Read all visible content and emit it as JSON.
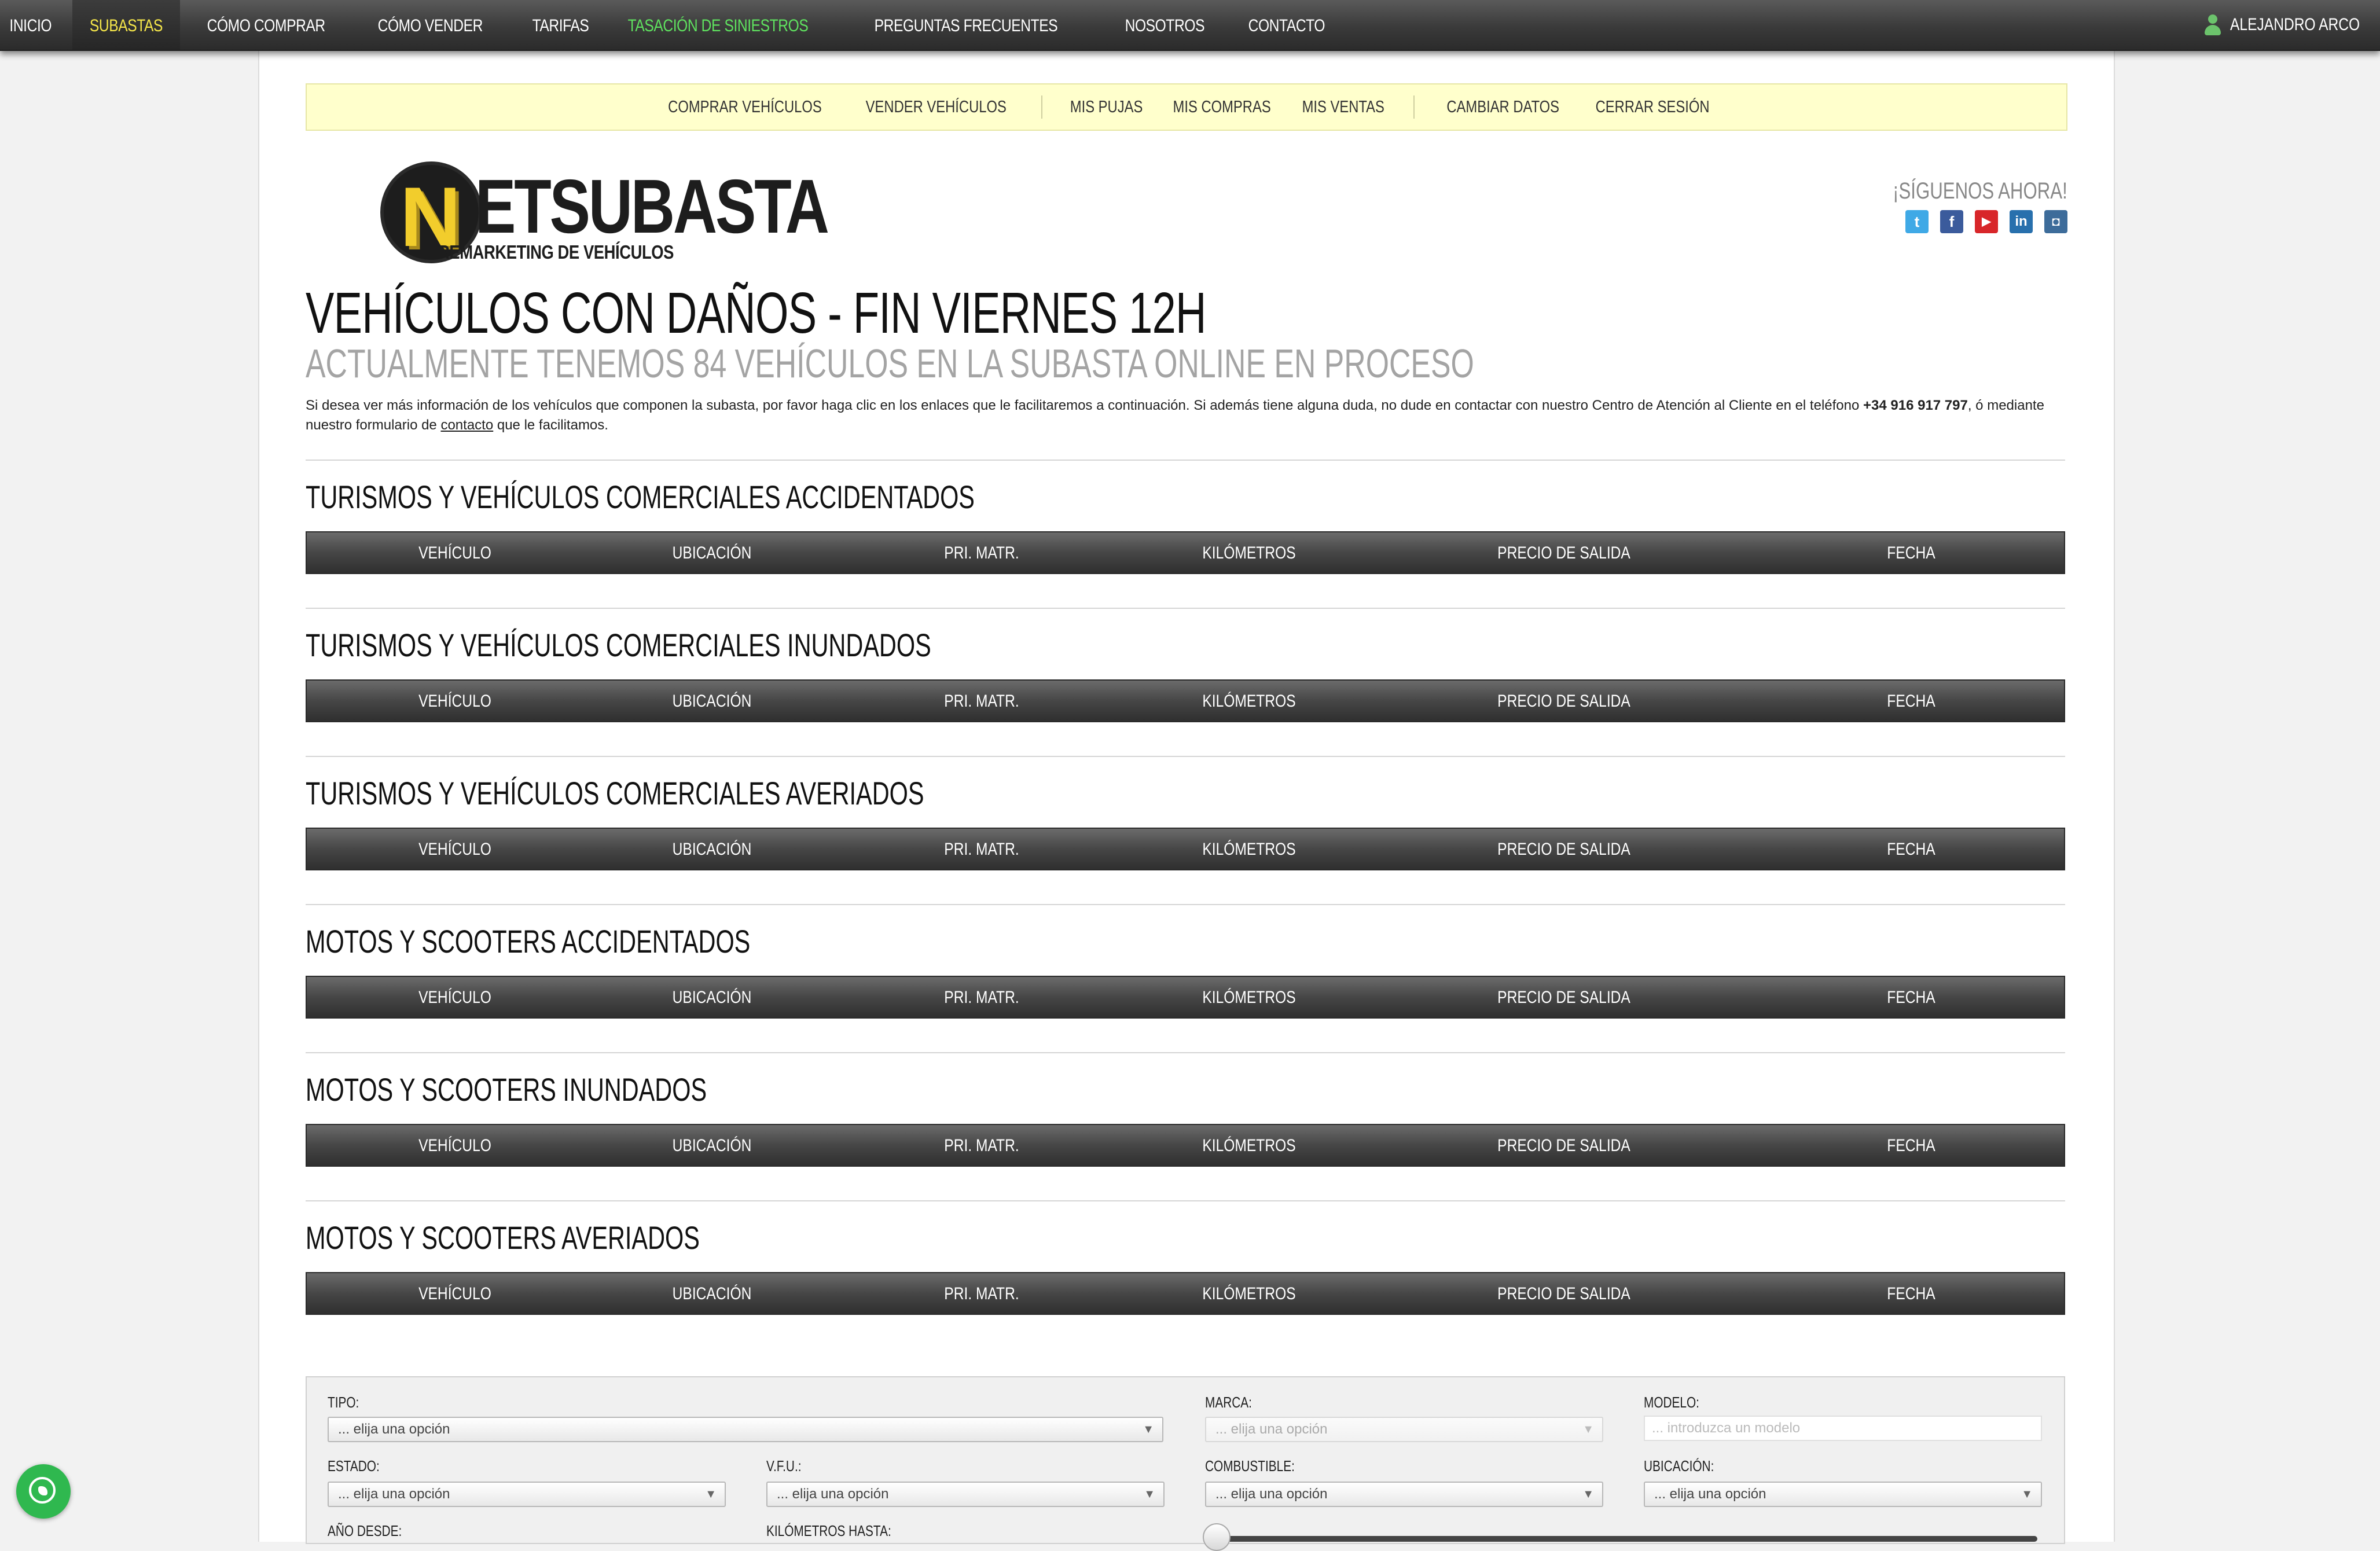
{
  "topnav": {
    "items": [
      {
        "label": "INICIO"
      },
      {
        "label": "SUBASTAS"
      },
      {
        "label": "CÓMO COMPRAR"
      },
      {
        "label": "CÓMO VENDER"
      },
      {
        "label": "TARIFAS"
      },
      {
        "label": "TASACIÓN DE SINIESTROS"
      },
      {
        "label": "PREGUNTAS FRECUENTES"
      },
      {
        "label": "NOSOTROS"
      },
      {
        "label": "CONTACTO"
      }
    ],
    "user": "ALEJANDRO ARCO",
    "active_color": "#f5e64a",
    "highlight_color": "#5fe25f"
  },
  "usernav": {
    "group1": [
      "COMPRAR VEHÍCULOS",
      "VENDER VEHÍCULOS"
    ],
    "group2": [
      "MIS PUJAS",
      "MIS COMPRAS",
      "MIS VENTAS"
    ],
    "group3": [
      "CAMBIAR DATOS",
      "CERRAR SESIÓN"
    ]
  },
  "logo": {
    "letter": "N",
    "word": "ETSUBASTA",
    "tagline": "REMARKETING DE VEHÍCULOS"
  },
  "social": {
    "label": "¡SÍGUENOS AHORA!",
    "icons": [
      "twitter-icon",
      "facebook-icon",
      "youtube-icon",
      "linkedin-icon",
      "instagram-icon"
    ]
  },
  "page": {
    "title": "VEHÍCULOS CON DAÑOS - FIN VIERNES 12H",
    "subtitle": "ACTUALMENTE TENEMOS 84 VEHÍCULOS EN LA SUBASTA ONLINE EN PROCESO",
    "intro_pre": "Si desea ver más información de los vehículos que componen la subasta, por favor haga clic en los enlaces que le facilitaremos a continuación. Si además tiene alguna duda, no dude en contactar con nuestro Centro de Atención al Cliente en el teléfono ",
    "phone": "+34 916 917 797",
    "intro_mid": ", ó mediante nuestro formulario de ",
    "contact_link": "contacto",
    "intro_post": " que le facilitamos."
  },
  "table_columns": [
    "VEHÍCULO",
    "UBICACIÓN",
    "PRI. MATR.",
    "KILÓMETROS",
    "PRECIO DE SALIDA",
    "FECHA"
  ],
  "sections": [
    {
      "title": "TURISMOS Y VEHÍCULOS COMERCIALES ACCIDENTADOS"
    },
    {
      "title": "TURISMOS Y VEHÍCULOS COMERCIALES INUNDADOS"
    },
    {
      "title": "TURISMOS Y VEHÍCULOS COMERCIALES AVERIADOS"
    },
    {
      "title": "MOTOS Y SCOOTERS ACCIDENTADOS"
    },
    {
      "title": "MOTOS Y SCOOTERS INUNDADOS"
    },
    {
      "title": "MOTOS Y SCOOTERS AVERIADOS"
    }
  ],
  "filters": {
    "tipo": {
      "label": "TIPO:",
      "value": "... elija una opción"
    },
    "marca": {
      "label": "MARCA:",
      "value": "... elija una opción"
    },
    "modelo": {
      "label": "MODELO:",
      "placeholder": "... introduzca un modelo"
    },
    "estado": {
      "label": "ESTADO:",
      "value": "... elija una opción"
    },
    "vfu": {
      "label": "V.F.U.:",
      "value": "... elija una opción"
    },
    "combustible": {
      "label": "COMBUSTIBLE:",
      "value": "... elija una opción"
    },
    "ubicacion": {
      "label": "UBICACIÓN:",
      "value": "... elija una opción"
    },
    "ano_desde": {
      "label": "AÑO DESDE:"
    },
    "km_hasta": {
      "label": "KILÓMETROS HASTA:"
    }
  }
}
